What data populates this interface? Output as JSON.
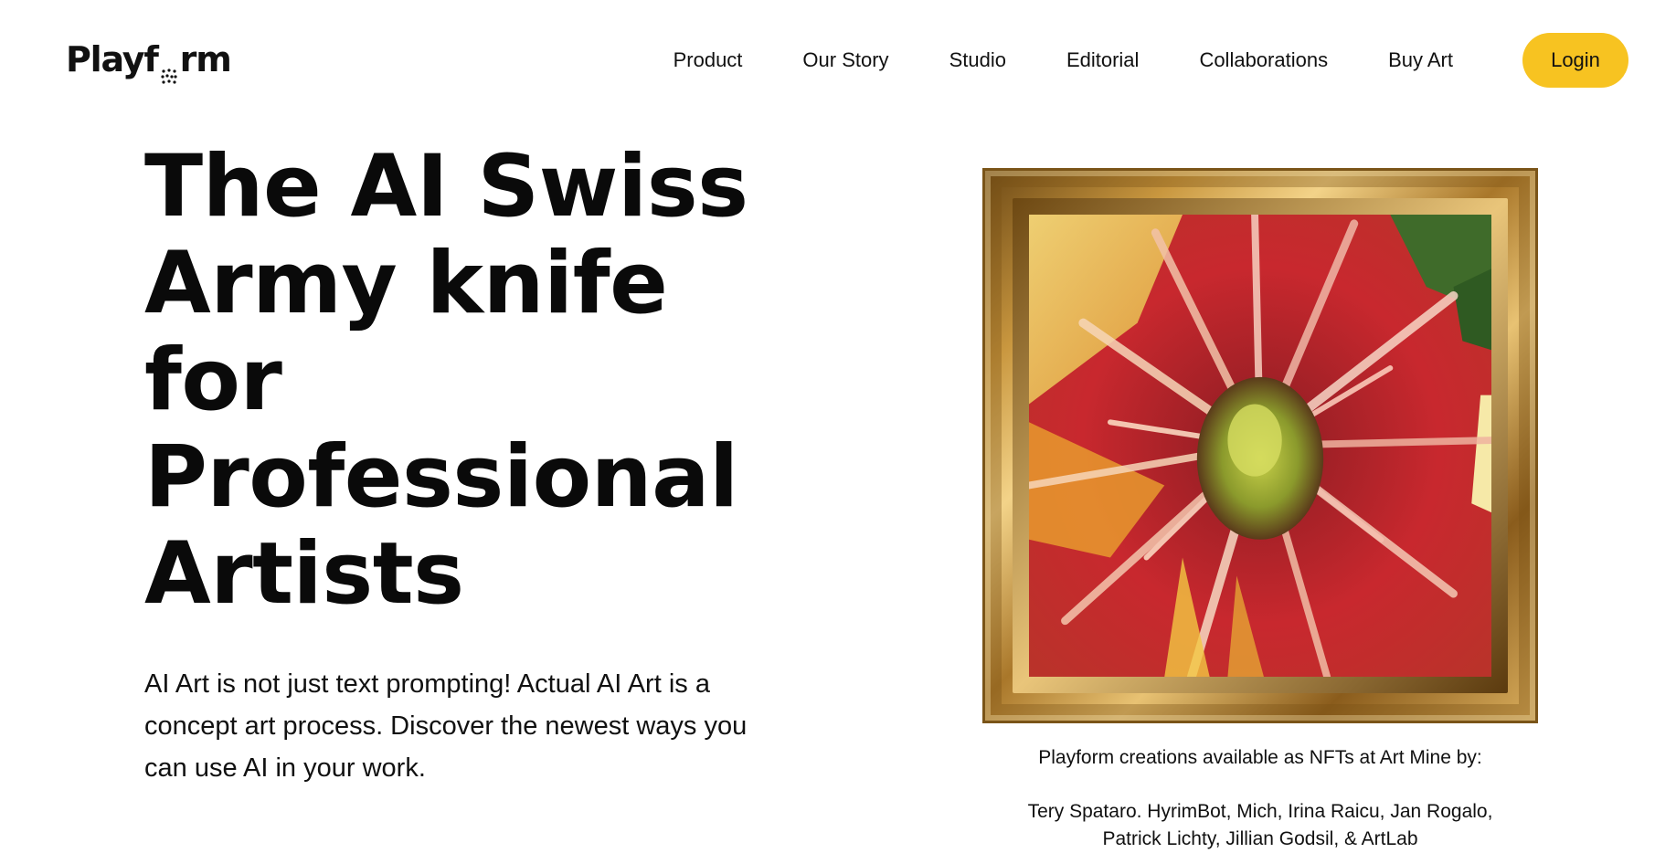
{
  "header": {
    "logo_text_left": "Playf",
    "logo_text_right": "rm",
    "nav": [
      "Product",
      "Our Story",
      "Studio",
      "Editorial",
      "Collaborations",
      "Buy Art"
    ],
    "login_label": "Login"
  },
  "hero": {
    "title_lines": [
      "The AI Swiss",
      "Army knife",
      "for",
      "Professional",
      "Artists"
    ],
    "description_lines": [
      "AI Art is not just text prompting! Actual AI Art is a",
      "concept art process. Discover the newest ways you",
      "can use AI in your work."
    ]
  },
  "artwork": {
    "caption": "Playform creations available as NFTs at Art Mine by:",
    "artists_line_1": "Tery Spataro. HyrimBot, Mich, Irina Raicu, Jan Rogalo,",
    "artists_line_2": "Patrick Lichty, Jillian Godsil, & ArtLab"
  },
  "colors": {
    "accent": "#f7c321",
    "text": "#111111",
    "background": "#ffffff"
  }
}
